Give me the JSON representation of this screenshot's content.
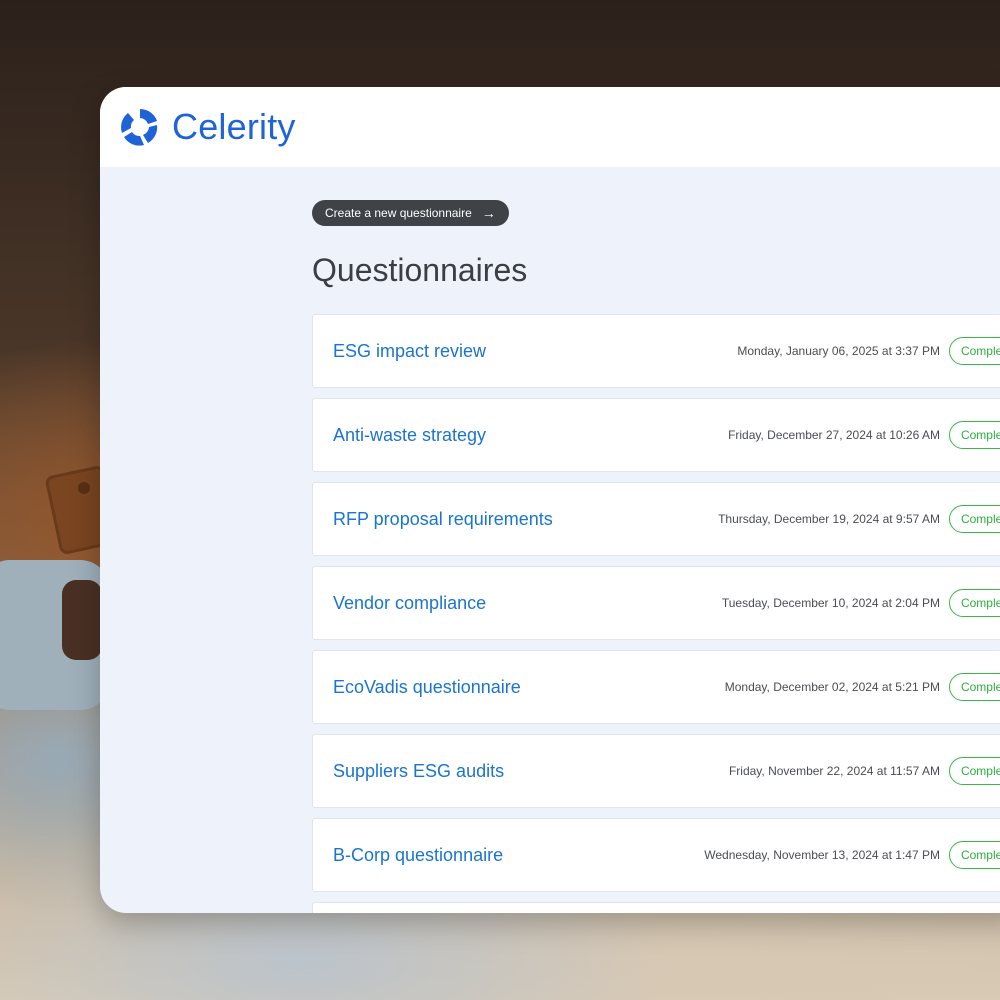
{
  "brand": {
    "name": "Celerity",
    "logo_icon": "celerity-logo-icon",
    "color": "#1f63d9"
  },
  "toolbar": {
    "create_label": "Create a new questionnaire",
    "create_icon": "arrow-right-icon"
  },
  "page": {
    "title": "Questionnaires"
  },
  "status_colors": {
    "completed": "#2eae3f"
  },
  "questionnaires": [
    {
      "title": "ESG impact review",
      "date": "Monday, January 06, 2025 at 3:37 PM",
      "status": "Completed"
    },
    {
      "title": "Anti-waste strategy",
      "date": "Friday, December 27, 2024 at 10:26 AM",
      "status": "Completed"
    },
    {
      "title": "RFP proposal requirements",
      "date": "Thursday, December 19, 2024 at 9:57 AM",
      "status": "Completed"
    },
    {
      "title": "Vendor compliance",
      "date": "Tuesday, December 10, 2024 at 2:04 PM",
      "status": "Completed"
    },
    {
      "title": "EcoVadis questionnaire",
      "date": "Monday, December 02, 2024 at 5:21 PM",
      "status": "Completed"
    },
    {
      "title": "Suppliers ESG audits",
      "date": "Friday, November 22, 2024 at 11:57 AM",
      "status": "Completed"
    },
    {
      "title": "B-Corp questionnaire",
      "date": "Wednesday, November 13, 2024 at 1:47 PM",
      "status": "Completed"
    }
  ]
}
